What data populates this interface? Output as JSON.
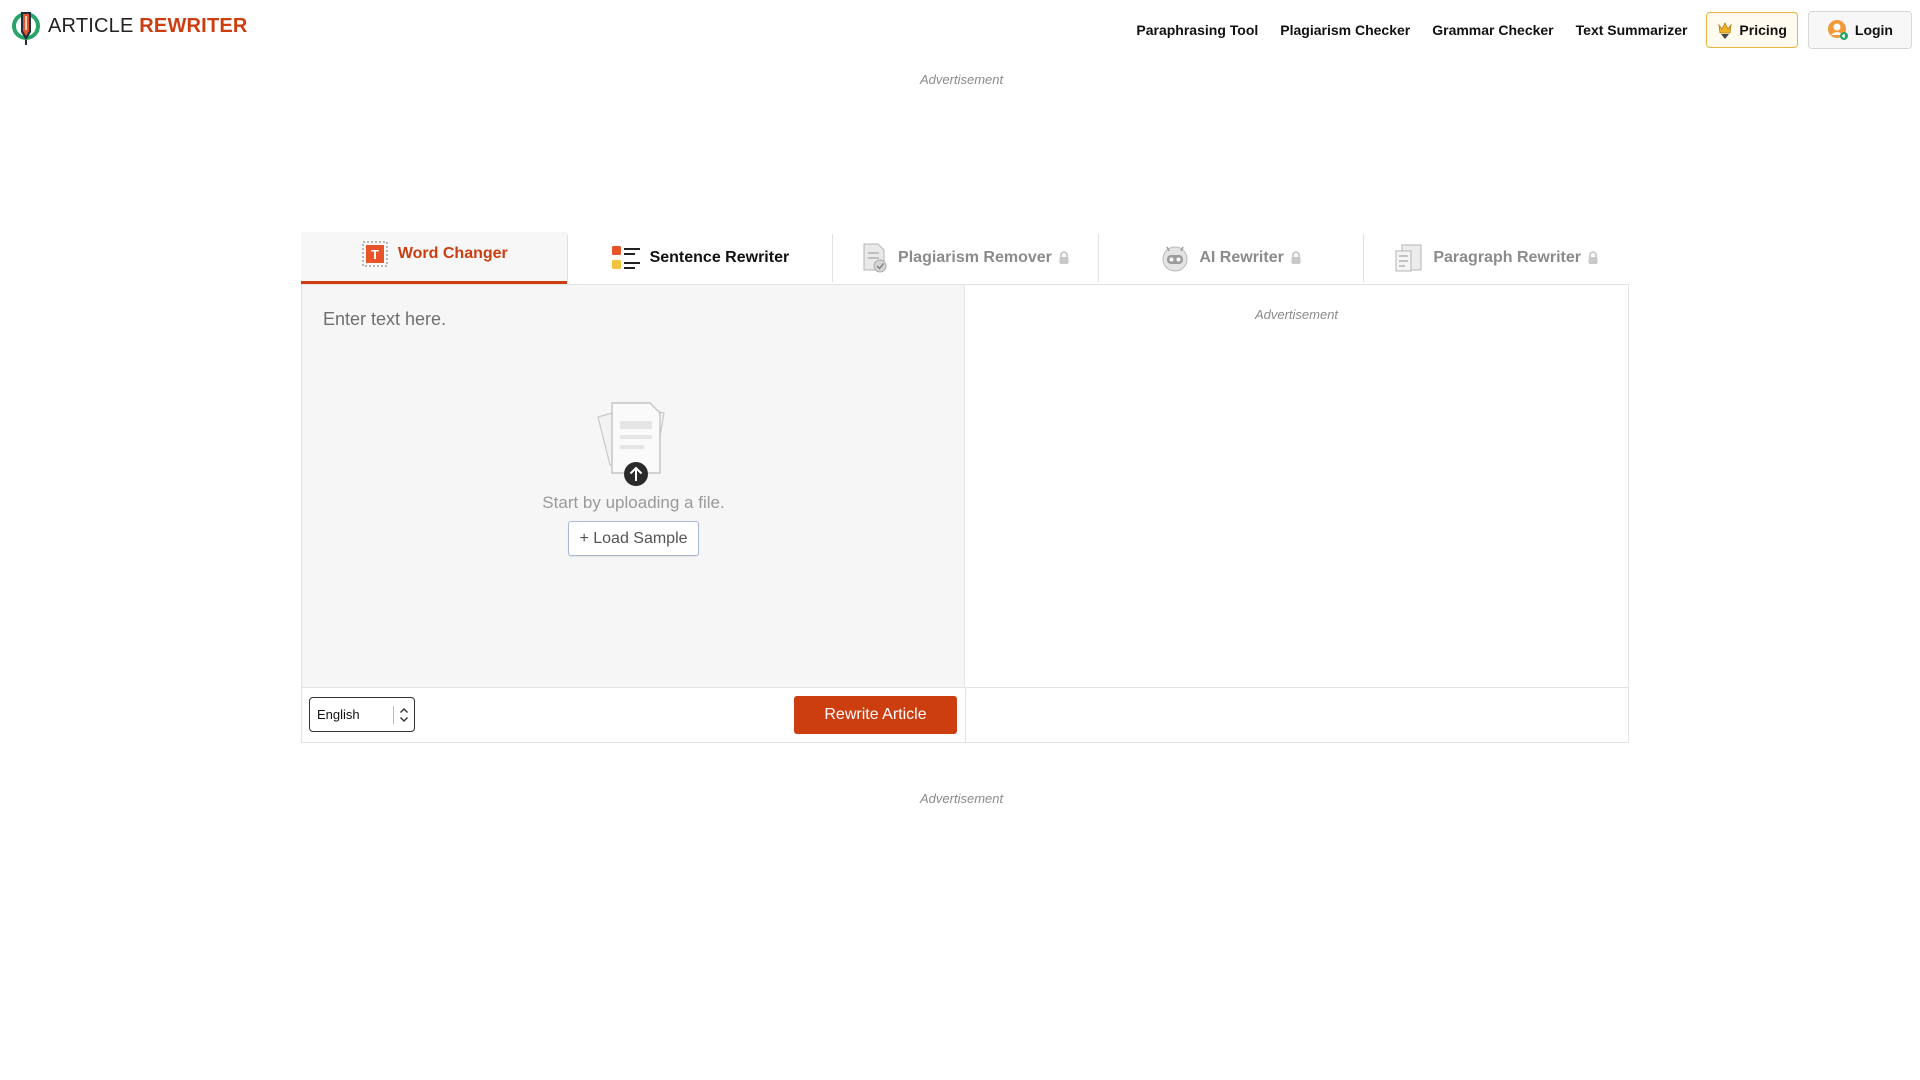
{
  "brand": {
    "name_plain": "ARTICLE",
    "name_accent": "REWRITER",
    "accent_color": "#cc3d10"
  },
  "nav": {
    "links": [
      {
        "label": "Paraphrasing Tool"
      },
      {
        "label": "Plagiarism Checker"
      },
      {
        "label": "Grammar Checker"
      },
      {
        "label": "Text Summarizer"
      }
    ],
    "pricing_label": "Pricing",
    "login_label": "Login"
  },
  "ads": {
    "top": "Advertisement",
    "output": "Advertisement",
    "bottom": "Advertisement"
  },
  "tabs": [
    {
      "label": "Word Changer",
      "icon": "word-changer-icon",
      "active": true,
      "locked": false
    },
    {
      "label": "Sentence Rewriter",
      "icon": "sentence-rewriter-icon",
      "active": false,
      "locked": false
    },
    {
      "label": "Plagiarism Remover",
      "icon": "plagiarism-remover-icon",
      "active": false,
      "locked": true
    },
    {
      "label": "AI Rewriter",
      "icon": "robot-icon",
      "active": false,
      "locked": true
    },
    {
      "label": "Paragraph Rewriter",
      "icon": "paragraph-rewriter-icon",
      "active": false,
      "locked": true
    }
  ],
  "editor": {
    "placeholder": "Enter text here.",
    "upload_text": "Start by uploading a file.",
    "load_sample_label": "+ Load Sample",
    "language": "English",
    "rewrite_label": "Rewrite Article"
  }
}
